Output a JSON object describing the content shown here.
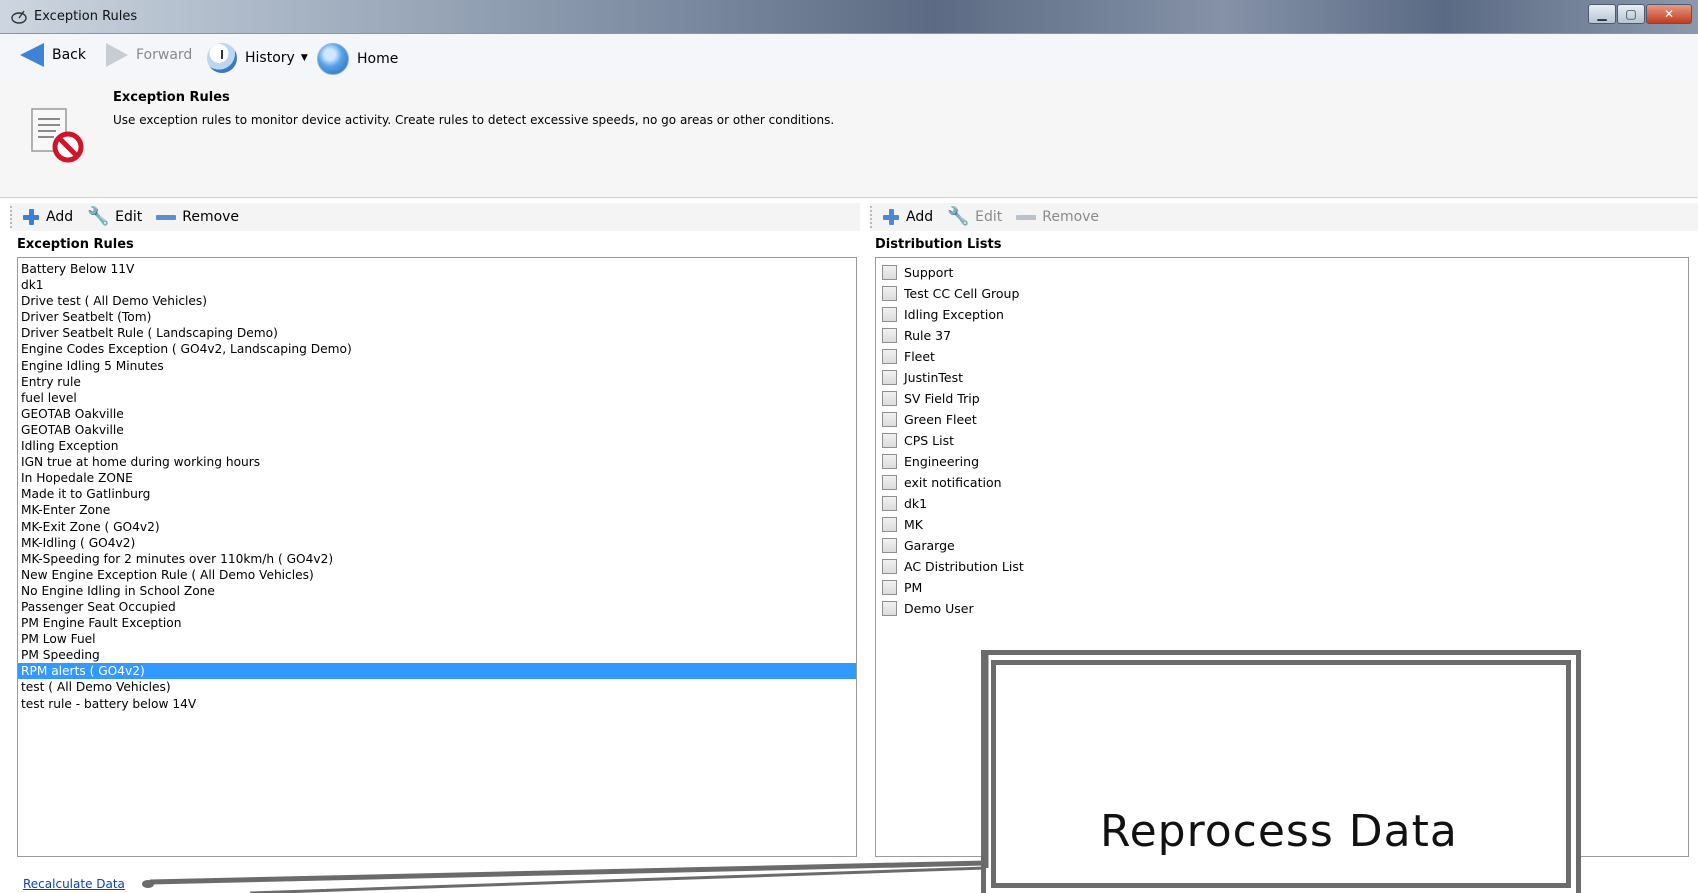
{
  "window": {
    "title": "Exception Rules"
  },
  "nav": {
    "back": "Back",
    "forward": "Forward",
    "history": "History",
    "home": "Home"
  },
  "header": {
    "title": "Exception Rules",
    "description": "Use exception rules to monitor device activity. Create rules to detect excessive speeds, no go areas or other conditions."
  },
  "left_toolbar": {
    "add": "Add",
    "edit": "Edit",
    "remove": "Remove"
  },
  "right_toolbar": {
    "add": "Add",
    "edit": "Edit",
    "remove": "Remove"
  },
  "rules_panel": {
    "title": "Exception Rules",
    "selected_index": 25,
    "items": [
      "Battery Below 11V",
      "dk1",
      "Drive test ( All Demo Vehicles)",
      "Driver Seatbelt (Tom)",
      "Driver Seatbelt Rule ( Landscaping Demo)",
      "Engine Codes Exception ( GO4v2, Landscaping Demo)",
      "Engine Idling 5 Minutes",
      "Entry rule",
      "fuel level",
      "GEOTAB Oakville",
      "GEOTAB Oakville",
      "Idling Exception",
      "IGN true at home during working hours",
      "In Hopedale ZONE",
      "Made it to Gatlinburg",
      "MK-Enter Zone",
      "MK-Exit Zone ( GO4v2)",
      "MK-Idling ( GO4v2)",
      "MK-Speeding for 2 minutes over 110km/h ( GO4v2)",
      "New Engine Exception Rule ( All Demo Vehicles)",
      "No Engine Idling in School Zone",
      "Passenger Seat Occupied",
      "PM Engine Fault Exception",
      "PM Low Fuel",
      "PM Speeding",
      "RPM alerts ( GO4v2)",
      "test ( All Demo Vehicles)",
      "test rule - battery below 14V"
    ]
  },
  "distribution_panel": {
    "title": "Distribution Lists",
    "items": [
      "Support",
      "Test CC Cell Group",
      "Idling Exception",
      "Rule 37",
      "Fleet",
      "JustinTest",
      "SV Field Trip",
      "Green Fleet",
      "CPS List",
      "Engineering",
      "exit notification",
      "dk1",
      "MK",
      "Gararge",
      "AC Distribution List",
      "PM",
      "Demo User"
    ]
  },
  "footer": {
    "recalculate": "Recalculate Data"
  },
  "callout": {
    "text": "Reprocess Data"
  },
  "colors": {
    "selection": "#3399ff",
    "accent": "#3f83d6",
    "callout_border": "#6b6b6b"
  }
}
